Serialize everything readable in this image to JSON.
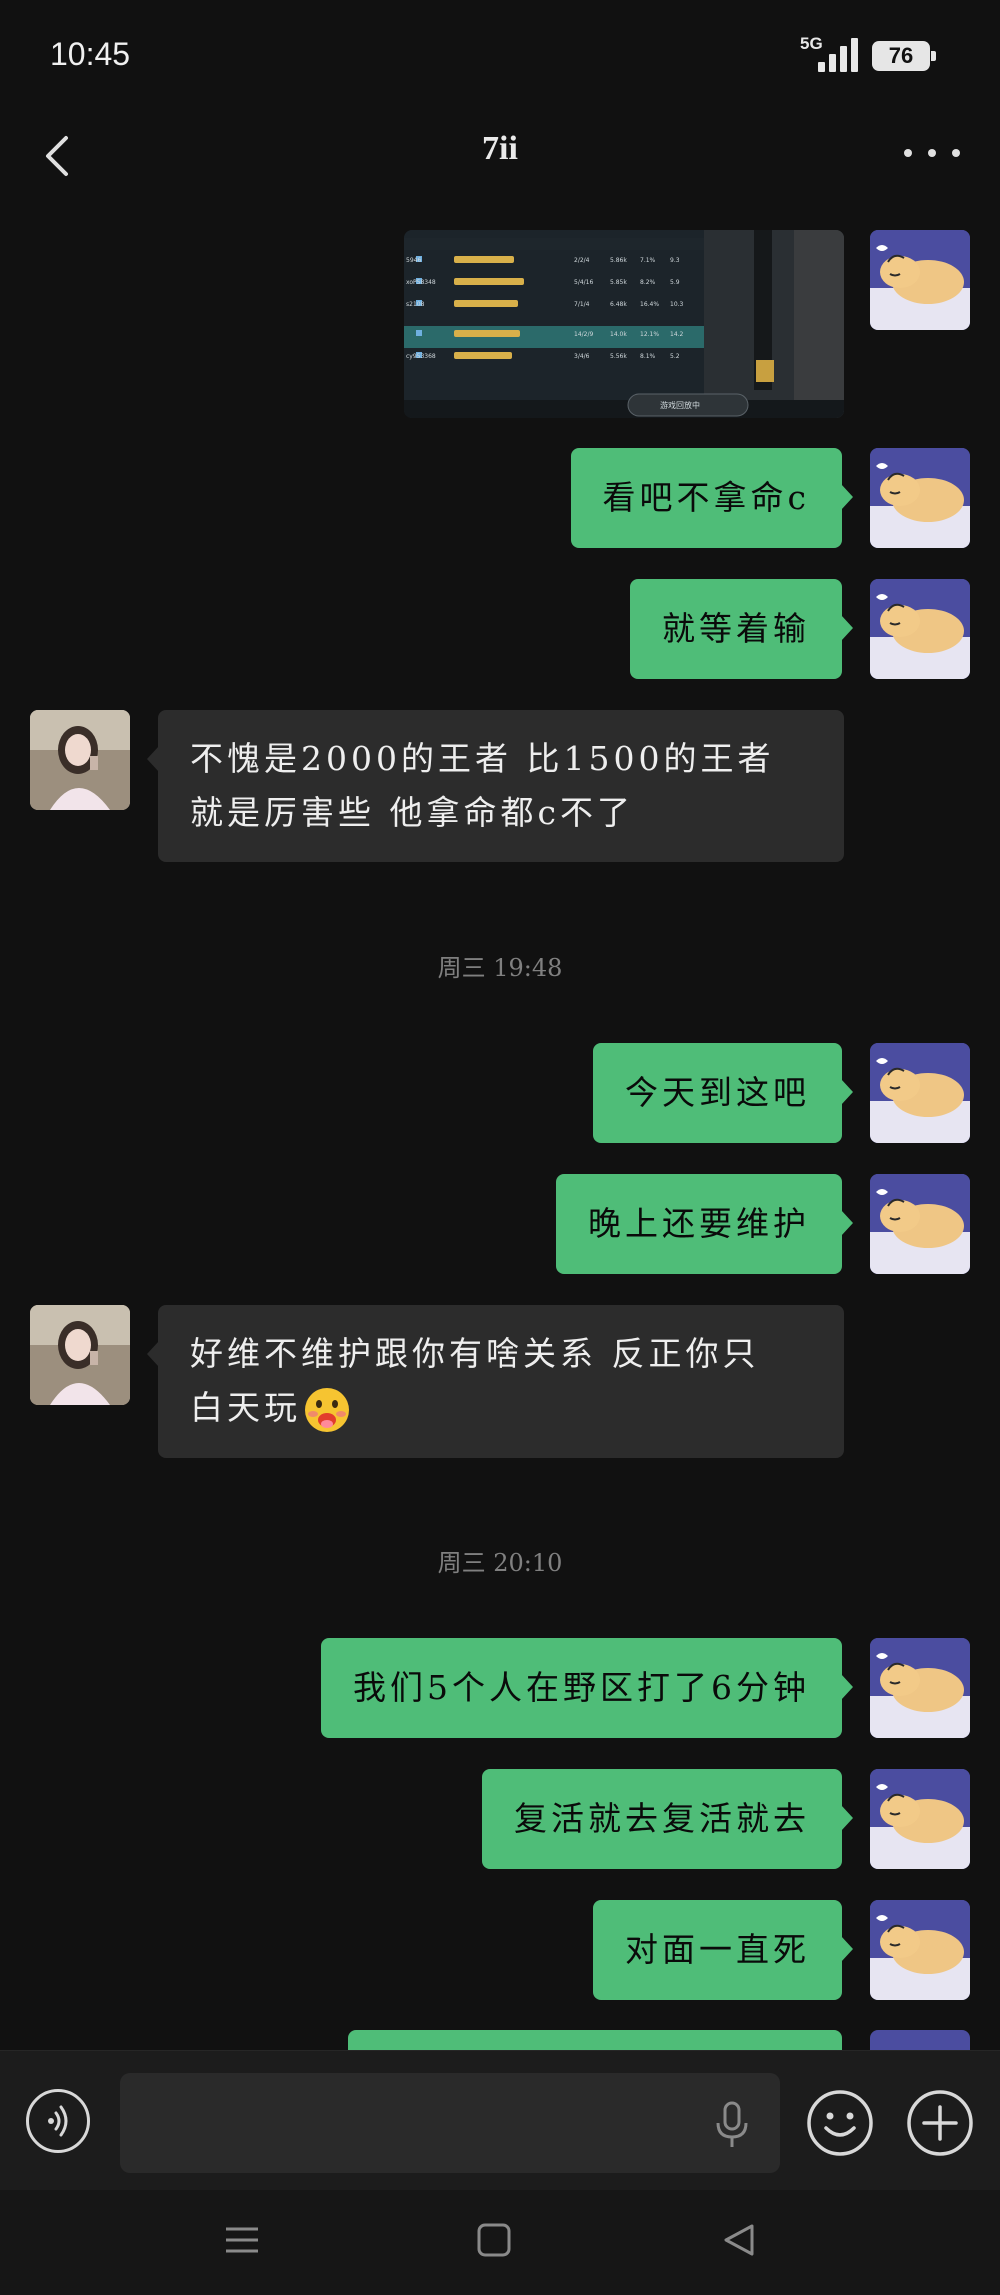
{
  "status": {
    "time": "10:45",
    "network": "5G",
    "battery": "76"
  },
  "header": {
    "title": "7ii"
  },
  "messages": {
    "m1": "看吧不拿命c",
    "m2": "就等着输",
    "m3_line1": "不愧是2000的王者 比1500的王者",
    "m3_line2": "就是厉害些 他拿命都c不了",
    "ts1": "周三 19:48",
    "m4": "今天到这吧",
    "m5": "晚上还要维护",
    "m6_line1": "好维不维护跟你有啥关系 反正你只",
    "m6_line2": "白天玩",
    "ts2": "周三 20:10",
    "m7": "我们5个人在野区打了6分钟",
    "m8": "复活就去复活就去",
    "m9": "对面一直死"
  },
  "screenshot": {
    "rows": [
      "5946",
      "xoP58348",
      "s2108",
      "",
      "cy953368"
    ],
    "kda": [
      "2/2/4",
      "5/4/16",
      "7/1/4",
      "14/2/9",
      "3/4/6"
    ],
    "gold": [
      "5.86k",
      "5.85k",
      "6.48k",
      "14.0k",
      "5.56k"
    ],
    "share": [
      "7.1%",
      "8.2%",
      "16.4%",
      "12.1%",
      "8.1%"
    ],
    "score": [
      "9.3",
      "5.9",
      "10.3",
      "14.2",
      "5.2"
    ],
    "button": "游戏回放中"
  },
  "colors": {
    "me_bubble": "#4fbd78",
    "other_bubble": "#2c2c2c",
    "background": "#111111"
  }
}
